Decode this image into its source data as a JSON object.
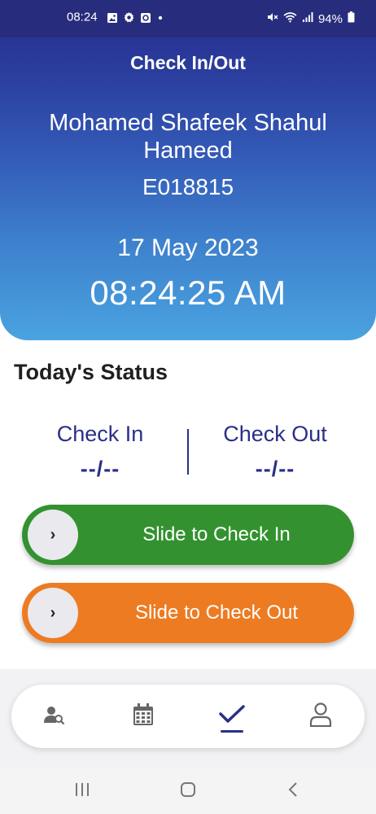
{
  "status_bar": {
    "time": "08:24",
    "battery": "94%",
    "left_icons": [
      "gallery-icon",
      "settings-icon",
      "app-icon",
      "dot-icon"
    ],
    "right_icons": [
      "mute-icon",
      "wifi-icon",
      "signal-icon",
      "battery-icon"
    ]
  },
  "header": {
    "title": "Check In/Out",
    "user_name": "Mohamed Shafeek Shahul Hameed",
    "employee_id": "E018815",
    "date": "17 May 2023",
    "time": "08:24:25 AM"
  },
  "status": {
    "heading": "Today's Status",
    "check_in_label": "Check In",
    "check_in_value": "--/--",
    "check_out_label": "Check Out",
    "check_out_value": "--/--"
  },
  "sliders": {
    "check_in": "Slide to Check In",
    "check_out": "Slide to Check Out",
    "knob_glyph": "›"
  },
  "bottom_nav": {
    "items": [
      "user-search-icon",
      "calendar-icon",
      "check-icon",
      "profile-icon"
    ],
    "active_index": 2
  },
  "system_nav": [
    "recents-icon",
    "home-icon",
    "back-icon"
  ],
  "colors": {
    "header_top": "#262c8e",
    "header_bottom": "#4aa3e0",
    "accent": "#2b2f86",
    "check_in_green": "#33922f",
    "check_out_orange": "#ed7b22"
  }
}
